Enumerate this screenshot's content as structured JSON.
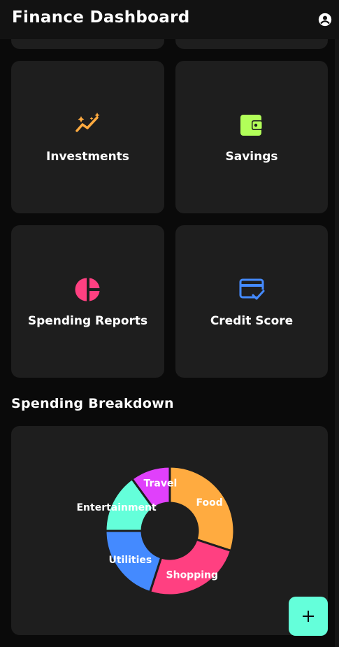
{
  "app": {
    "title": "Finance Dashboard",
    "account_icon": "account-circle-icon"
  },
  "cards": [
    {
      "label": "Investments",
      "icon": "trending-up-icon",
      "color": "#ffab40"
    },
    {
      "label": "Savings",
      "icon": "wallet-icon",
      "color": "#b2ff59"
    },
    {
      "label": "Spending Reports",
      "icon": "pie-chart-icon",
      "color": "#ff4081"
    },
    {
      "label": "Credit Score",
      "icon": "credit-score-icon",
      "color": "#448aff"
    }
  ],
  "spending": {
    "title": "Spending Breakdown"
  },
  "chart_data": {
    "type": "pie",
    "donut": true,
    "categories": [
      "Food",
      "Shopping",
      "Utilities",
      "Entertainment",
      "Travel"
    ],
    "values": [
      30,
      25,
      20,
      15,
      10
    ],
    "colors": [
      "#ffab40",
      "#ff4081",
      "#448aff",
      "#64ffda",
      "#e040fb"
    ]
  },
  "fab": {
    "icon": "plus-icon",
    "color": "#64ffda"
  }
}
